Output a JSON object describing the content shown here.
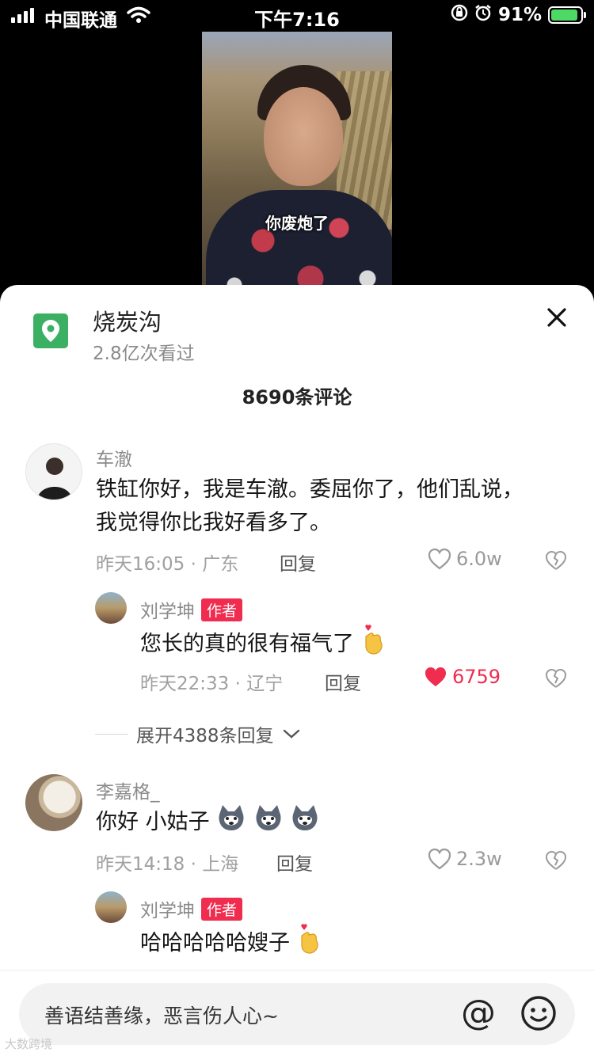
{
  "status_bar": {
    "carrier": "中国联通",
    "time": "下午7:16",
    "battery": "91%",
    "battery_level": 0.91
  },
  "video": {
    "subtitle": "你废炮了"
  },
  "location": {
    "title": "烧炭沟",
    "views": "2.8亿次看过",
    "icon": "location-pin-icon"
  },
  "comments_header": "8690条评论",
  "comments": [
    {
      "nick": "车澈",
      "text": "铁缸你好，我是车澈。委屈你了，他们乱说，我觉得你比我好看多了。",
      "meta": "昨天16:05 · 广东",
      "reply": "回复",
      "likes": "6.0w",
      "liked": false
    },
    {
      "nick": "刘学坤",
      "badge": "作者",
      "text": "您长的真的很有福气了",
      "meta": "昨天22:33 · 辽宁",
      "reply": "回复",
      "likes": "6759",
      "liked": true
    },
    {
      "nick": "李嘉格_",
      "text": "你好 小姑子",
      "meta": "昨天14:18 · 上海",
      "reply": "回复",
      "likes": "2.3w",
      "liked": false
    },
    {
      "nick": "刘学坤",
      "badge": "作者",
      "text": "哈哈哈哈哈嫂子"
    }
  ],
  "expand_replies": "展开4388条回复",
  "input": {
    "placeholder": "善语结善缘，恶言伤人心~",
    "at_label": "@"
  },
  "watermark": "大数跨境",
  "colors": {
    "accent_red": "#f02c4f",
    "location_green": "#3cb062"
  }
}
